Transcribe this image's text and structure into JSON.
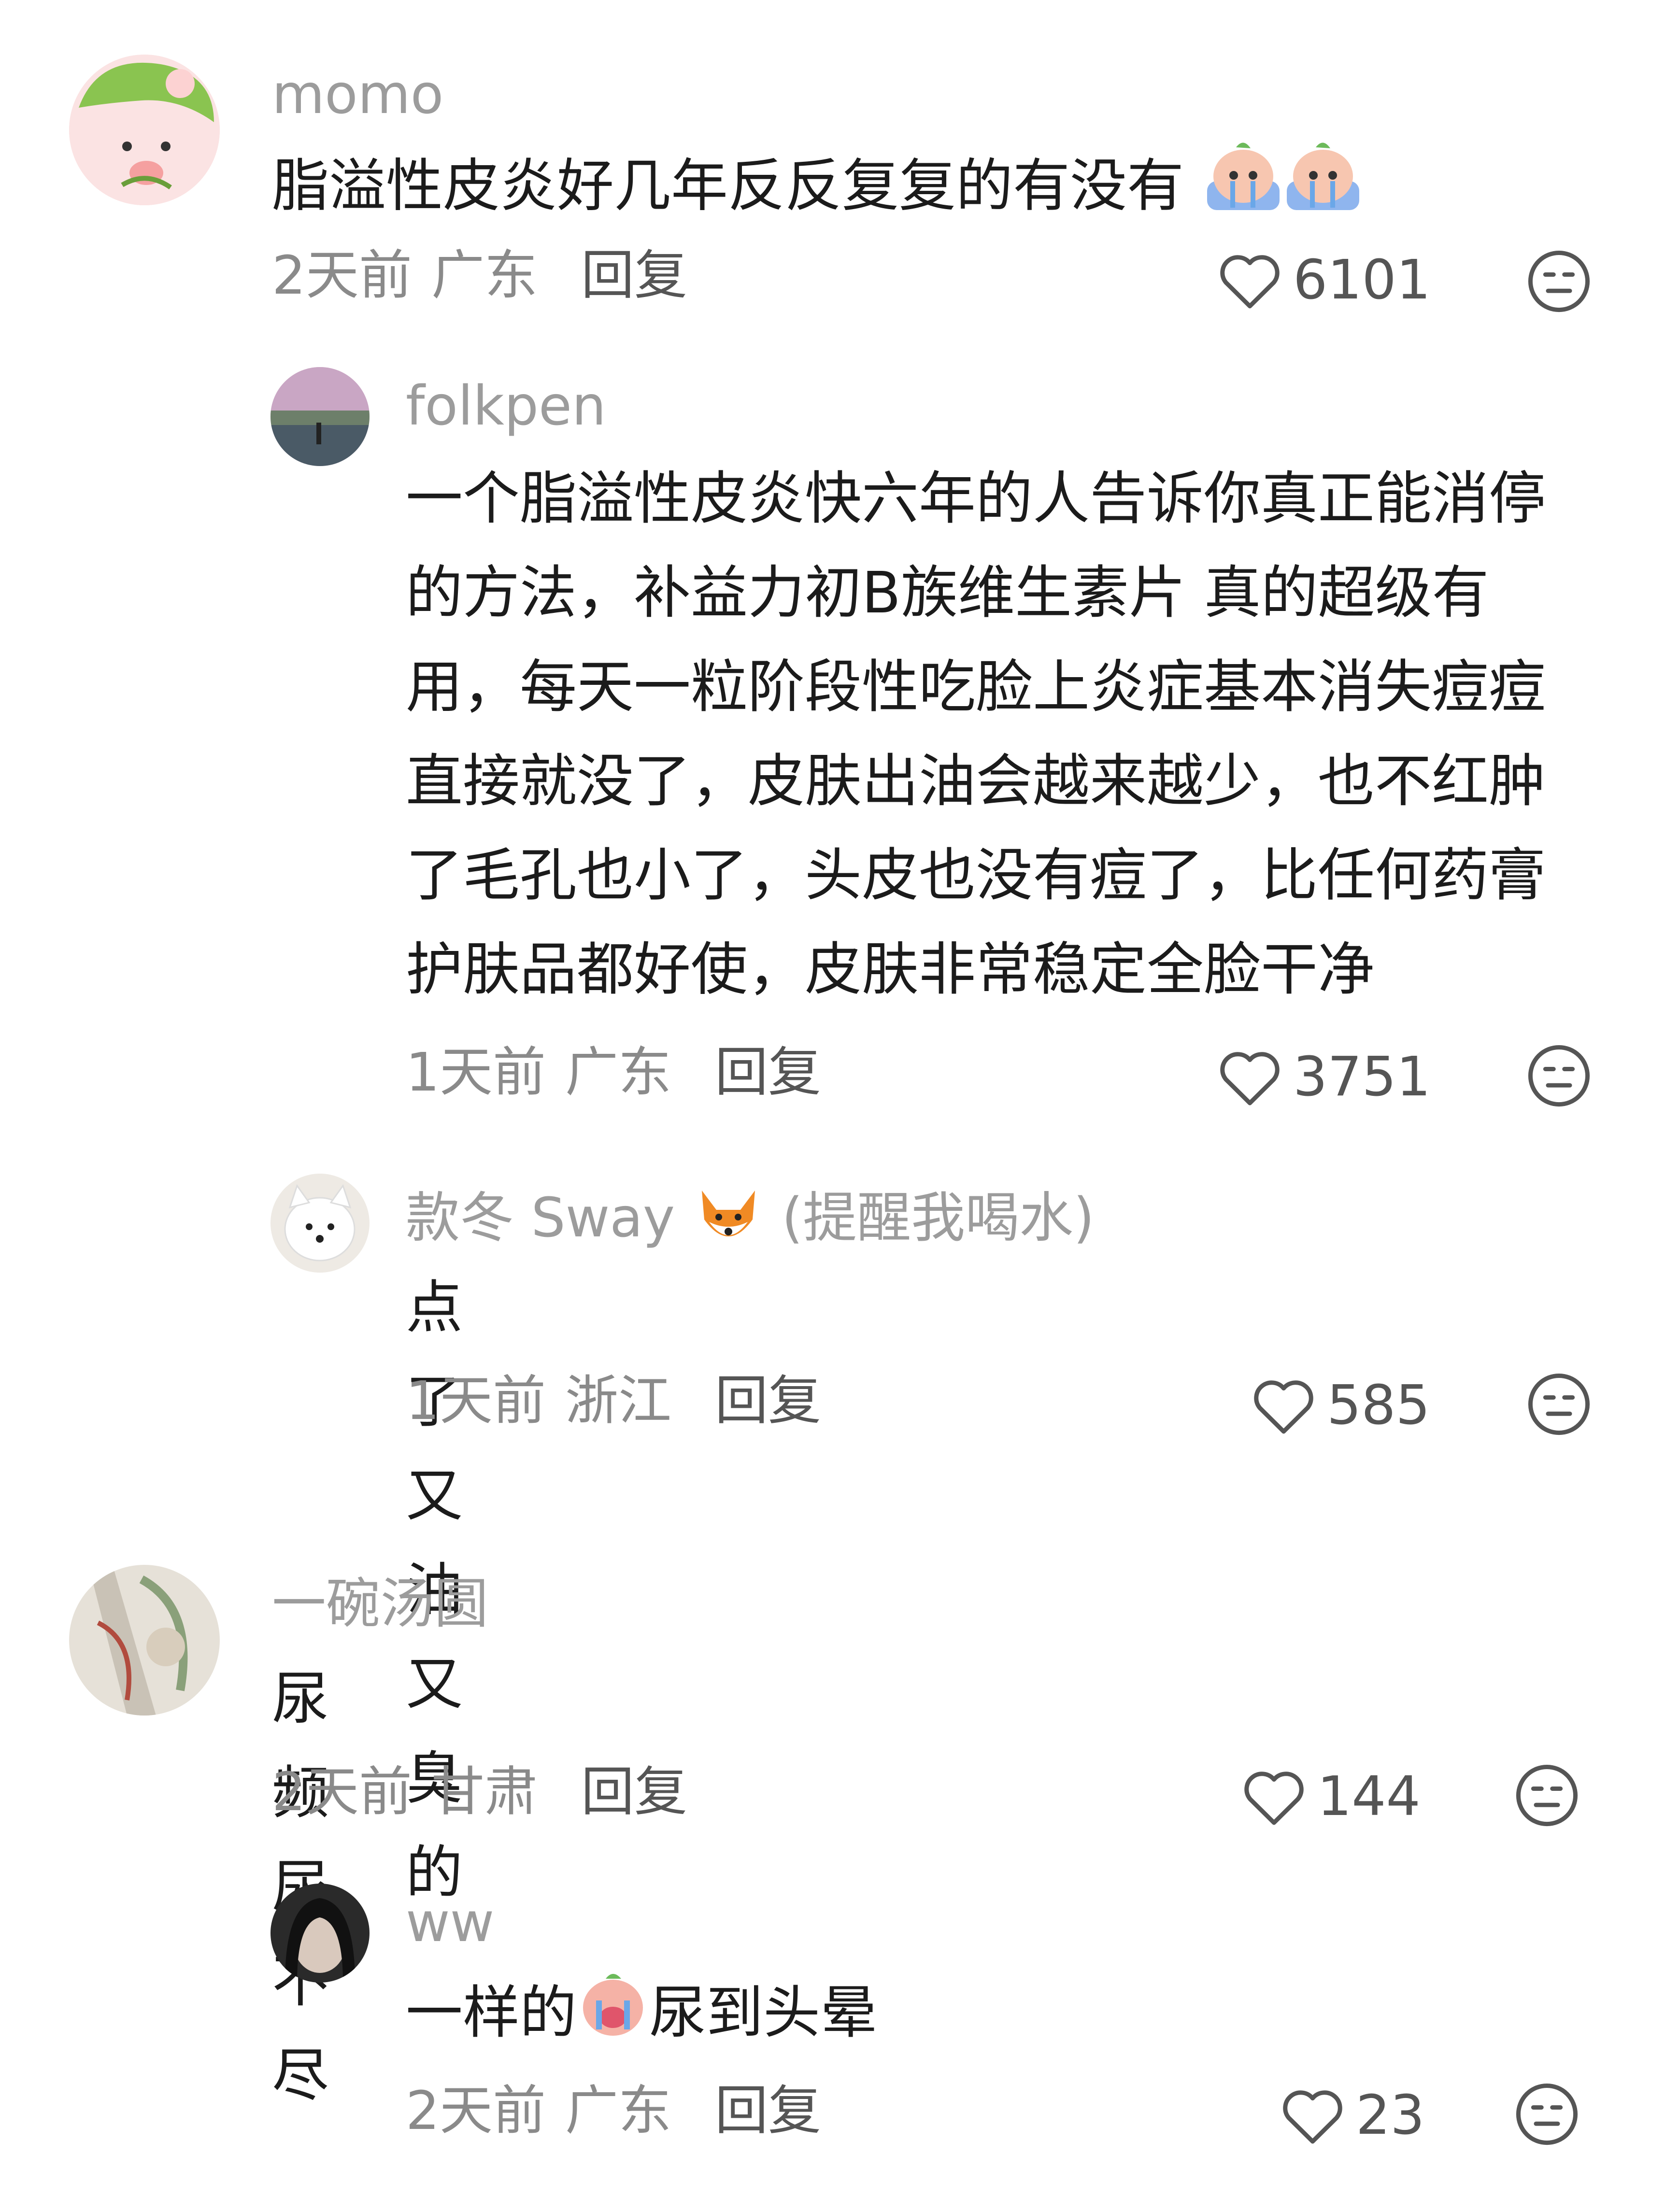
{
  "comments": [
    {
      "user": "momo",
      "text": "脂溢性皮炎好几年反反复复的有没有",
      "time": "2天前",
      "location": "广东",
      "reply_label": "回复",
      "likes": "6101",
      "emoji": "crying-peach-emoji"
    },
    {
      "user": "folkpen",
      "text": "一个脂溢性皮炎快六年的人告诉你真正能消停的方法，补益力初B族维生素片 真的超级有用，每天一粒阶段性吃脸上炎症基本消失痘痘直接就没了，皮肤出油会越来越少，也不红肿了毛孔也小了，头皮也没有痘了，比任何药膏护肤品都好使，皮肤非常稳定全脸干净",
      "time": "1天前",
      "location": "广东",
      "reply_label": "回复",
      "likes": "3751"
    },
    {
      "user": "款冬 Sway",
      "user_suffix": "(提醒我喝水)",
      "text": "点了 又油又臭的",
      "time": "1天前",
      "location": "浙江",
      "reply_label": "回复",
      "likes": "585",
      "emoji": "fox-emoji"
    },
    {
      "user": "一碗汤圆",
      "text": "尿频尿不尽",
      "time": "2天前",
      "location": "甘肃",
      "reply_label": "回复",
      "likes": "144"
    },
    {
      "user": "ww",
      "text_before": "一样的",
      "text_after": "尿到头晕",
      "time": "2天前",
      "location": "广东",
      "reply_label": "回复",
      "likes": "23",
      "emoji": "crying-peach-emoji"
    }
  ],
  "icons": {
    "like": "heart-outline-icon",
    "more": "neutral-face-icon"
  },
  "colors": {
    "text": "#1b1b1b",
    "muted": "#9c9c9c",
    "icon": "#555555"
  }
}
